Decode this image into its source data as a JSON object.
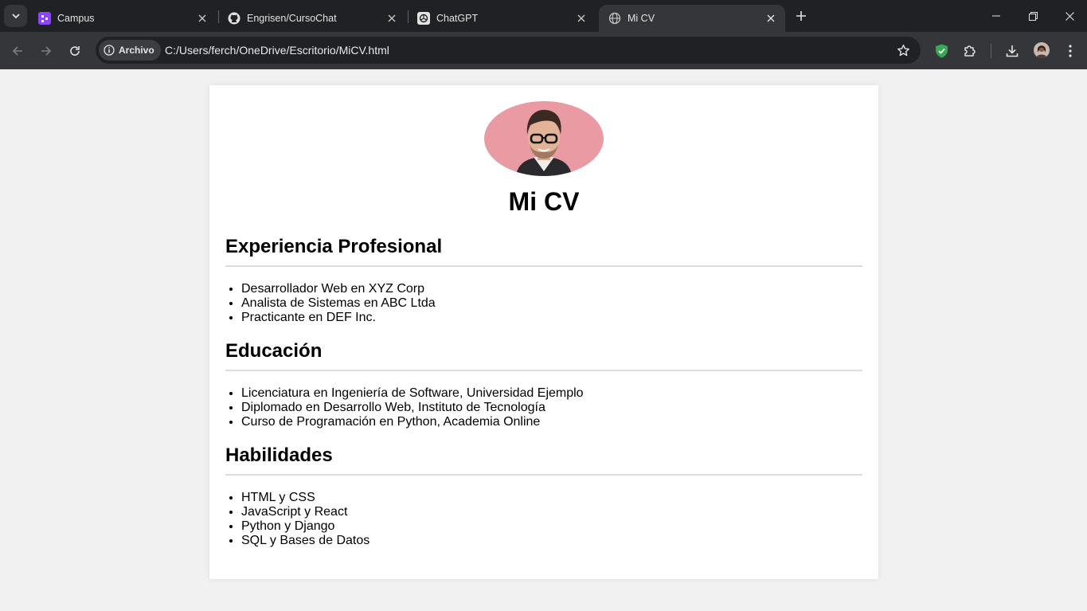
{
  "browser": {
    "tabs": [
      {
        "title": "Campus",
        "icon": "campus-icon",
        "active": false
      },
      {
        "title": "Engrisen/CursoChat",
        "icon": "github-icon",
        "active": false
      },
      {
        "title": "ChatGPT",
        "icon": "chatgpt-icon",
        "active": false
      },
      {
        "title": "Mi CV",
        "icon": "globe-icon",
        "active": true
      }
    ],
    "omnibox": {
      "chip_label": "Archivo",
      "url": "C:/Users/ferch/OneDrive/Escritorio/MiCV.html"
    },
    "colors": {
      "tabstrip_bg": "#202124",
      "toolbar_bg": "#35363a",
      "shield_green": "#34a853",
      "campus_purple": "#8e44ff"
    }
  },
  "cv": {
    "title": "Mi CV",
    "sections": [
      {
        "heading": "Experiencia Profesional",
        "items": [
          "Desarrollador Web en XYZ Corp",
          "Analista de Sistemas en ABC Ltda",
          "Practicante en DEF Inc."
        ]
      },
      {
        "heading": "Educación",
        "items": [
          "Licenciatura en Ingeniería de Software, Universidad Ejemplo",
          "Diplomado en Desarrollo Web, Instituto de Tecnología",
          "Curso de Programación en Python, Academia Online"
        ]
      },
      {
        "heading": "Habilidades",
        "items": [
          "HTML y CSS",
          "JavaScript y React",
          "Python y Django",
          "SQL y Bases de Datos"
        ]
      }
    ]
  }
}
